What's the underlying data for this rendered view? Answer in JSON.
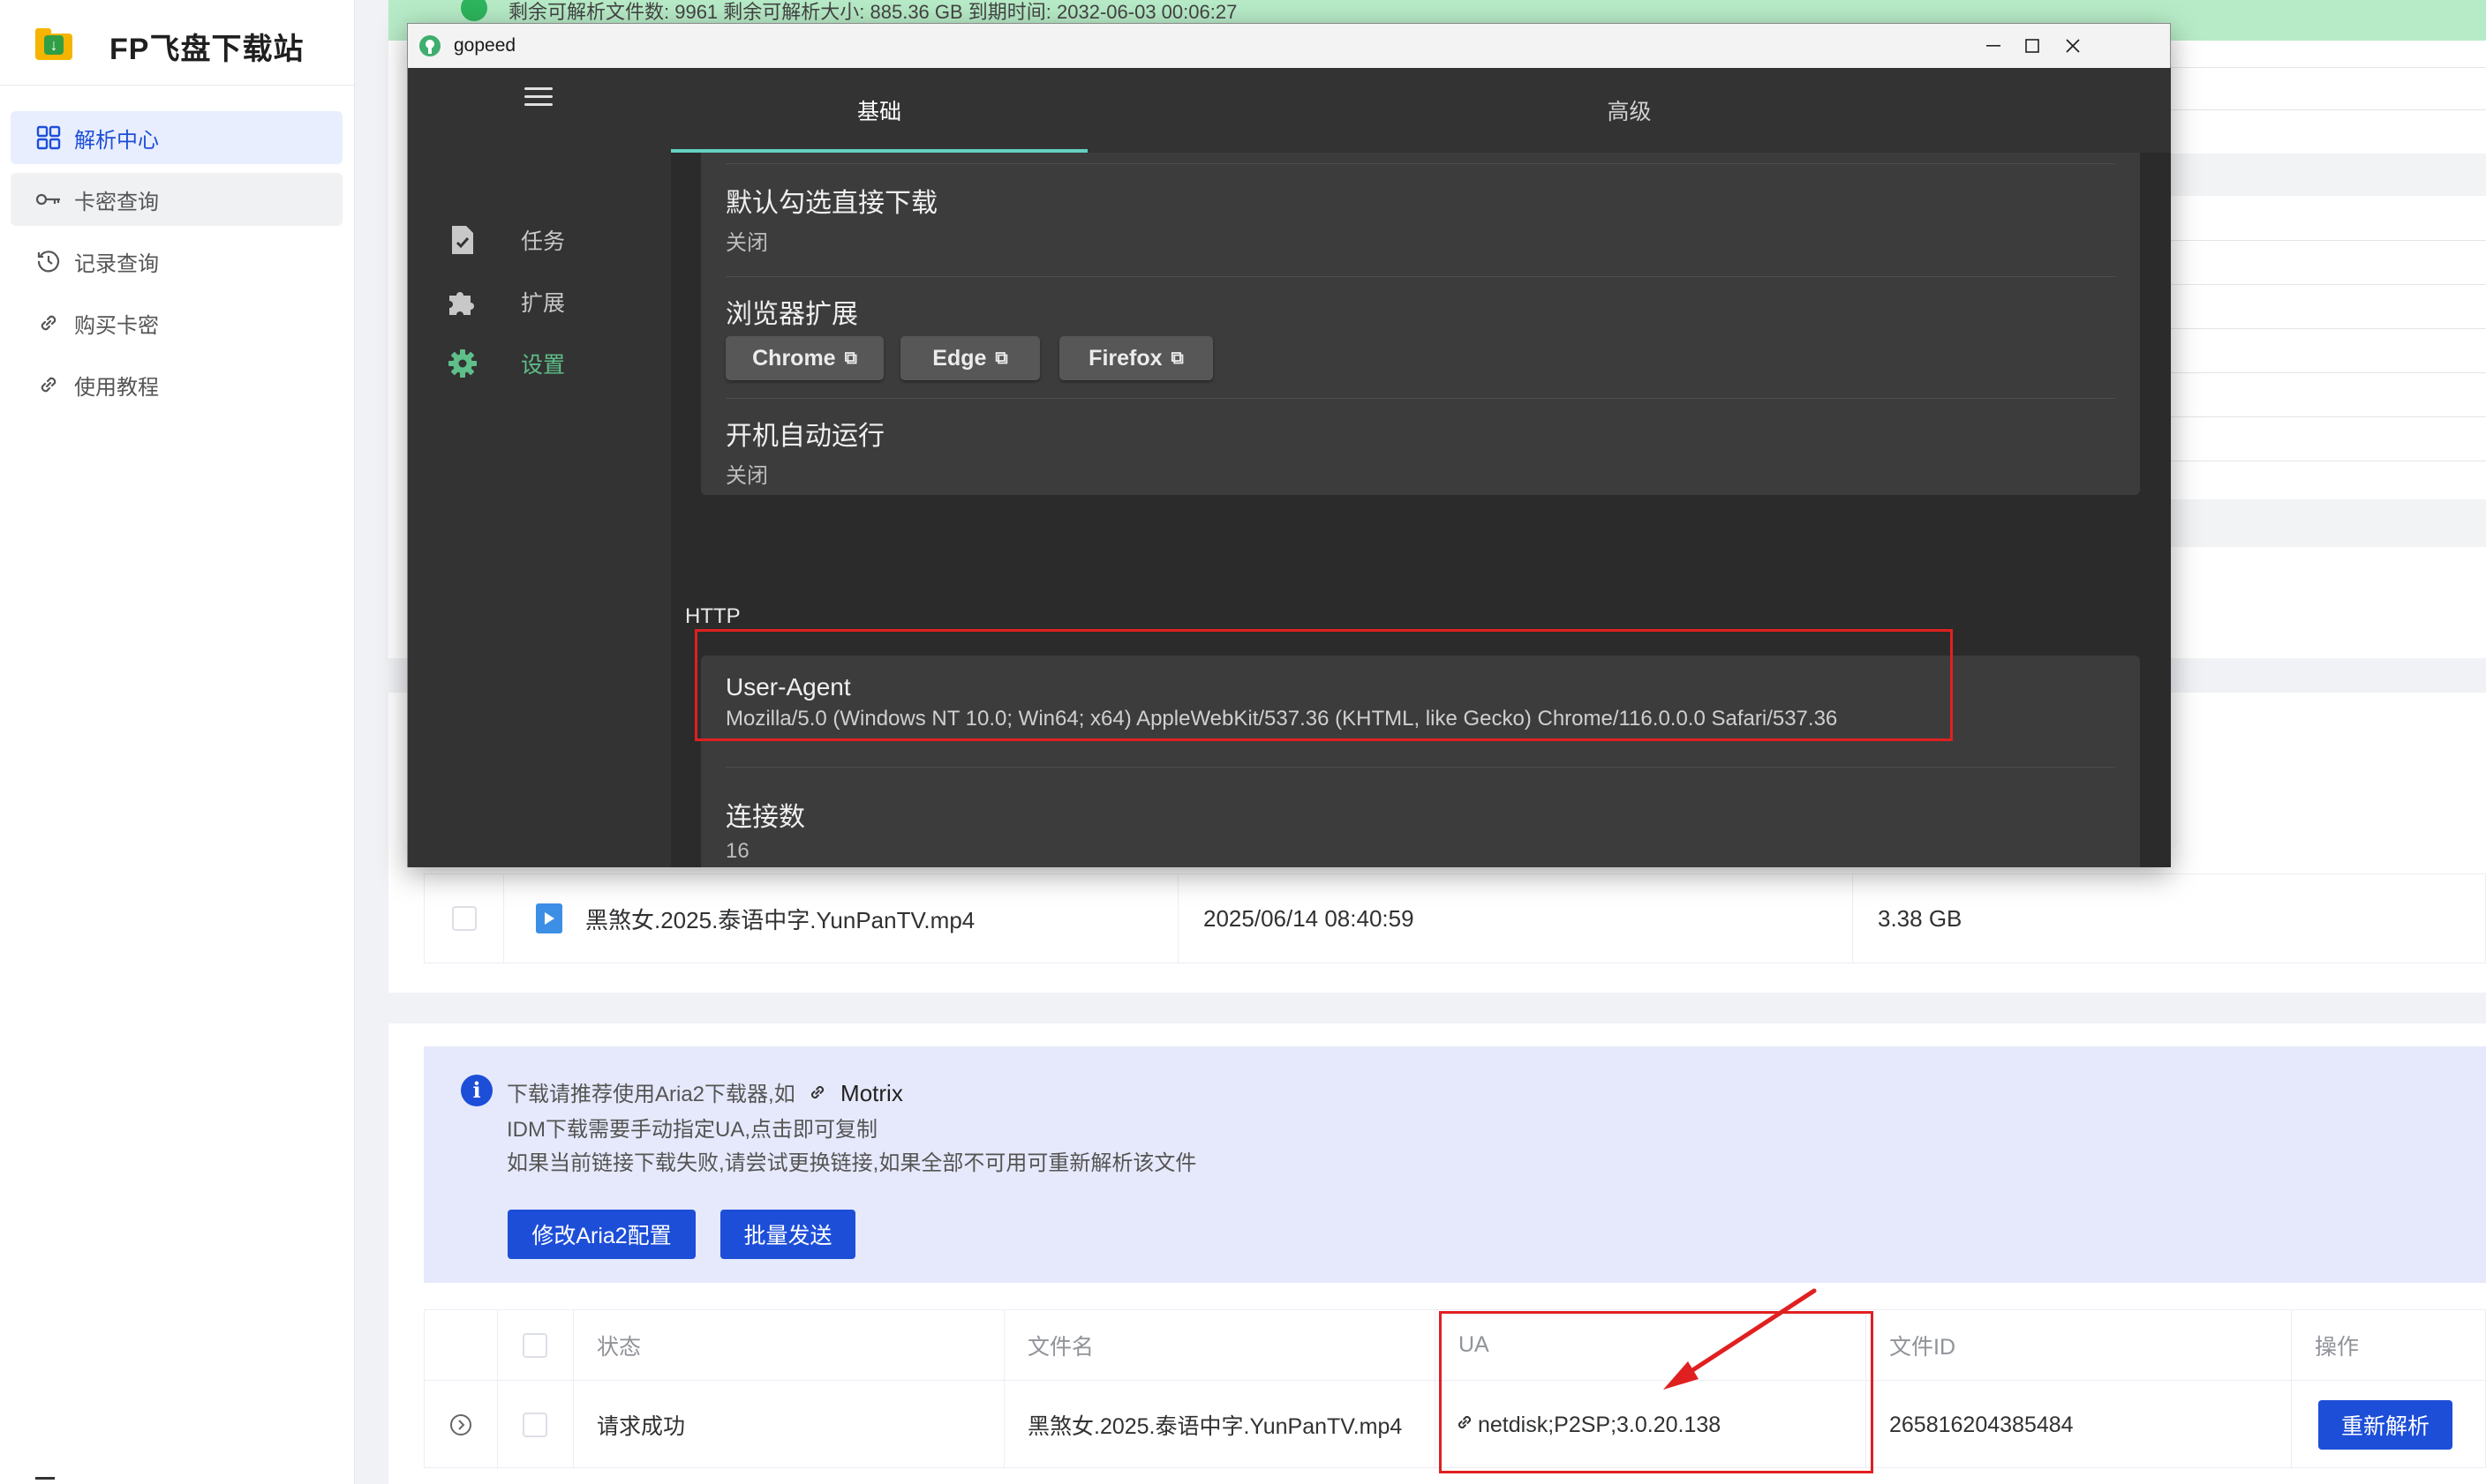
{
  "site": {
    "title": "FP飞盘下载站"
  },
  "sidebar": {
    "items": [
      {
        "label": "解析中心",
        "icon": "grid-icon",
        "active": true
      },
      {
        "label": "卡密查询",
        "icon": "key-icon"
      },
      {
        "label": "记录查询",
        "icon": "history-icon"
      },
      {
        "label": "购买卡密",
        "icon": "link-icon"
      },
      {
        "label": "使用教程",
        "icon": "link-icon"
      }
    ]
  },
  "banner": {
    "text": "剩余可解析文件数: 9961    剩余可解析大小: 885.36 GB    到期时间: 2032-06-03 00:06:27",
    "color": "#b7ebc7"
  },
  "file_row": {
    "name": "黑煞女.2025.泰语中字.YunPanTV.mp4",
    "date": "2025/06/14 08:40:59",
    "size": "3.38 GB"
  },
  "info": {
    "line1_prefix": "下载请推荐使用Aria2下载器,如",
    "line1_link": "Motrix",
    "line2": "IDM下载需要手动指定UA,点击即可复制",
    "line3": "如果当前链接下载失败,请尝试更换链接,如果全部不可用可重新解析该文件",
    "btn_aria2": "修改Aria2配置",
    "btn_batch": "批量发送"
  },
  "result_table": {
    "headers": [
      "状态",
      "文件名",
      "UA",
      "文件ID",
      "操作"
    ],
    "row": {
      "status": "请求成功",
      "filename": "黑煞女.2025.泰语中字.YunPanTV.mp4",
      "ua": "netdisk;P2SP;3.0.20.138",
      "file_id": "265816204385484",
      "action": "重新解析"
    }
  },
  "gopeed": {
    "window_title": "gopeed",
    "rail": {
      "tasks": "任务",
      "extensions": "扩展",
      "settings": "设置"
    },
    "tabs": {
      "basic": "基础",
      "advanced": "高级"
    },
    "settings": {
      "default_direct_title": "默认勾选直接下载",
      "default_direct_value": "关闭",
      "browser_ext_title": "浏览器扩展",
      "ext_buttons": [
        "Chrome",
        "Edge",
        "Firefox"
      ],
      "autostart_title": "开机自动运行",
      "autostart_value": "关闭",
      "http_section": "HTTP",
      "ua_title": "User-Agent",
      "ua_value": "Mozilla/5.0 (Windows NT 10.0; Win64; x64) AppleWebKit/537.36 (KHTML, like Gecko) Chrome/116.0.0.0 Safari/537.36",
      "connections_title": "连接数",
      "connections_value": "16"
    },
    "accent_color": "#64d1c1",
    "active_color": "#5fbf8a"
  },
  "colors": {
    "primary": "#1d4ed8",
    "highlight": "#e02020"
  }
}
